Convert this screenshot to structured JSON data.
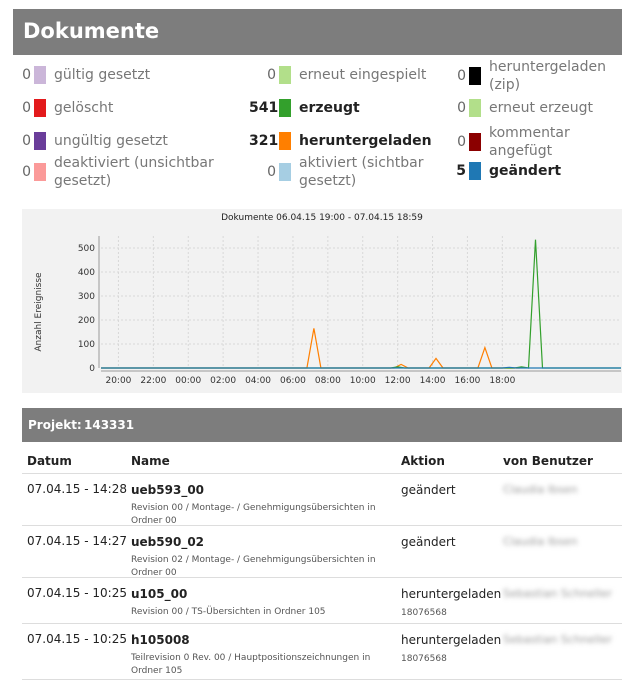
{
  "page": {
    "title": "Dokumente"
  },
  "legend": [
    {
      "count": "0",
      "label": "gültig gesetzt",
      "color": "#cbb6d9",
      "strong": false,
      "col": 0,
      "row": 0
    },
    {
      "count": "0",
      "label": "gelöscht",
      "color": "#e31a1c",
      "strong": false,
      "col": 0,
      "row": 1
    },
    {
      "count": "0",
      "label": "ungültig gesetzt",
      "color": "#6a3d9a",
      "strong": false,
      "col": 0,
      "row": 2
    },
    {
      "count": "0",
      "label": "deaktiviert (unsichtbar gesetzt)",
      "color": "#fb9a99",
      "strong": false,
      "col": 0,
      "row": 3
    },
    {
      "count": "0",
      "label": "erneut eingespielt",
      "color": "#b2df8a",
      "strong": false,
      "col": 1,
      "row": 0
    },
    {
      "count": "541",
      "label": "erzeugt",
      "color": "#33a02c",
      "strong": true,
      "col": 1,
      "row": 1
    },
    {
      "count": "321",
      "label": "heruntergeladen",
      "color": "#ff7f00",
      "strong": true,
      "col": 1,
      "row": 2
    },
    {
      "count": "0",
      "label": "aktiviert (sichtbar gesetzt)",
      "color": "#a6cee3",
      "strong": false,
      "col": 1,
      "row": 3
    },
    {
      "count": "0",
      "label": "heruntergeladen (zip)",
      "color": "#000000",
      "strong": false,
      "col": 2,
      "row": 0
    },
    {
      "count": "0",
      "label": "erneut erzeugt",
      "color": "#b2df8a",
      "strong": false,
      "col": 2,
      "row": 1
    },
    {
      "count": "0",
      "label": "kommentar angefügt",
      "color": "#8b0000",
      "strong": false,
      "col": 2,
      "row": 2
    },
    {
      "count": "5",
      "label": "geändert",
      "color": "#1f78b4",
      "strong": true,
      "col": 2,
      "row": 3
    }
  ],
  "chart_data": {
    "type": "line",
    "title": "Dokumente 06.04.15 19:00 - 07.04.15 18:59",
    "xlabel": "",
    "ylabel": "Anzahl Ereignisse",
    "x_ticks": [
      "20:00",
      "22:00",
      "00:00",
      "02:00",
      "04:00",
      "06:00",
      "08:00",
      "10:00",
      "12:00",
      "14:00",
      "16:00",
      "18:00"
    ],
    "x_range_hours": [
      19,
      43
    ],
    "ylim": [
      0,
      550
    ],
    "y_ticks": [
      0,
      100,
      200,
      300,
      400,
      500
    ],
    "grid": true,
    "series": [
      {
        "name": "heruntergeladen",
        "color": "#ff7f00",
        "x": [
          19,
          25,
          30.8,
          31.2,
          31.6,
          35.8,
          36.2,
          36.6,
          37.8,
          38.2,
          38.6,
          40.6,
          41.0,
          41.4,
          42.6,
          43
        ],
        "y": [
          0,
          0,
          0,
          165,
          0,
          0,
          15,
          0,
          0,
          40,
          0,
          0,
          85,
          0,
          0,
          0
        ]
      },
      {
        "name": "erzeugt",
        "color": "#33a02c",
        "x": [
          19,
          35.6,
          36.0,
          36.4,
          42.7,
          43.1,
          43.5,
          43.9,
          44.3,
          48.8
        ],
        "y": [
          0,
          0,
          5,
          0,
          0,
          5,
          0,
          535,
          0,
          0
        ]
      },
      {
        "name": "geändert",
        "color": "#1f78b4",
        "x": [
          19,
          42.0,
          42.4,
          42.8,
          48.8
        ],
        "y": [
          0,
          0,
          3,
          0,
          0
        ]
      }
    ]
  },
  "project": {
    "label": "Projekt:",
    "id": "143331"
  },
  "table": {
    "headers": {
      "date": "Datum",
      "name": "Name",
      "action": "Aktion",
      "user": "von Benutzer"
    },
    "rows": [
      {
        "date": "07.04.15 - 14:28",
        "name": "ueb593_00",
        "sub": "Revision 00 / Montage- / Genehmigungsübersichten in Ordner 00",
        "action": "geändert",
        "action_id": "",
        "user": "Claudia Ibsen"
      },
      {
        "date": "07.04.15 - 14:27",
        "name": "ueb590_02",
        "sub": "Revision 02 / Montage- / Genehmigungsübersichten in Ordner 00",
        "action": "geändert",
        "action_id": "",
        "user": "Claudia Ibsen"
      },
      {
        "date": "07.04.15 - 10:25",
        "name": "u105_00",
        "sub": "Revision 00 / TS-Übersichten in Ordner 105",
        "action": "heruntergeladen",
        "action_id": "18076568",
        "user": "Sebastian Schneller"
      },
      {
        "date": "07.04.15 - 10:25",
        "name": "h105008",
        "sub": "Teilrevision 0 Rev. 00 / Hauptpositionszeichnungen in Ordner 105",
        "action": "heruntergeladen",
        "action_id": "18076568",
        "user": "Sebastian Schneller"
      }
    ]
  }
}
